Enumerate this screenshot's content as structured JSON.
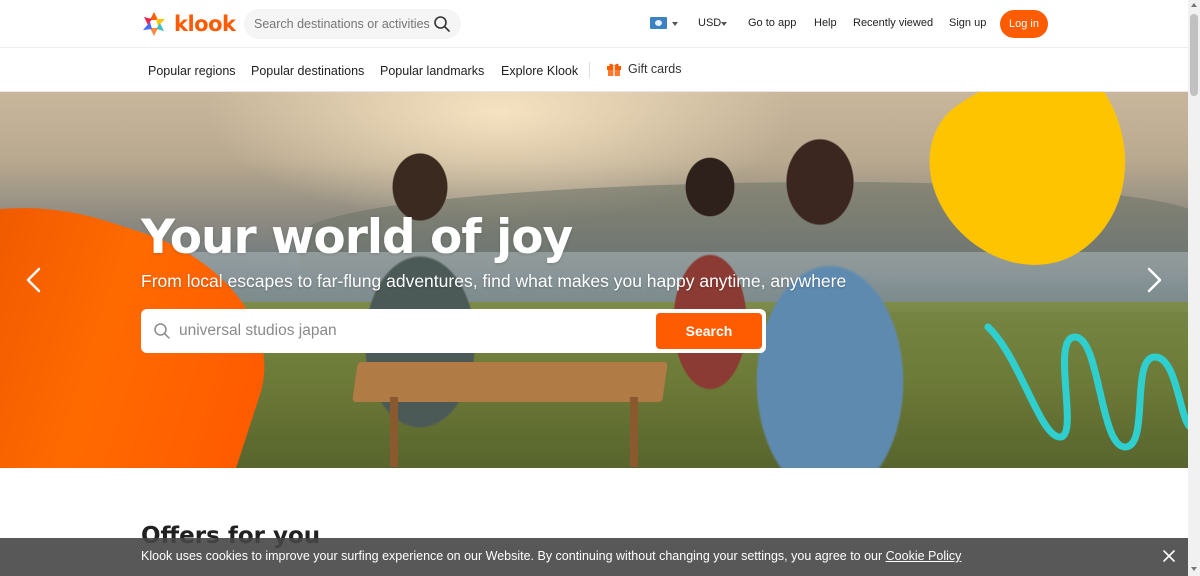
{
  "brand": {
    "name": "klook",
    "accent": "#ff5b00"
  },
  "header": {
    "search_placeholder": "Search destinations or activities",
    "currency": "USD",
    "links": [
      "Go to app",
      "Help",
      "Recently viewed",
      "Sign up"
    ],
    "login_label": "Log in"
  },
  "subnav": {
    "items": [
      "Popular regions",
      "Popular destinations",
      "Popular landmarks",
      "Explore Klook"
    ],
    "gift_label": "Gift cards"
  },
  "hero": {
    "title": "Your world of joy",
    "subtitle": "From local escapes to far-flung adventures, find what makes you happy anytime, anywhere",
    "search_value": "universal studios japan",
    "search_button": "Search"
  },
  "offers": {
    "title": "Offers for you"
  },
  "cookie": {
    "text": "Klook uses cookies to improve your surfing experience on our Website. By continuing without changing your settings, you agree to our ",
    "link": "Cookie Policy"
  },
  "icons": {
    "search": "search-icon",
    "flag": "flag-icon",
    "gift": "gift-icon",
    "prev": "chevron-left-icon",
    "next": "chevron-right-icon",
    "close": "close-icon"
  }
}
